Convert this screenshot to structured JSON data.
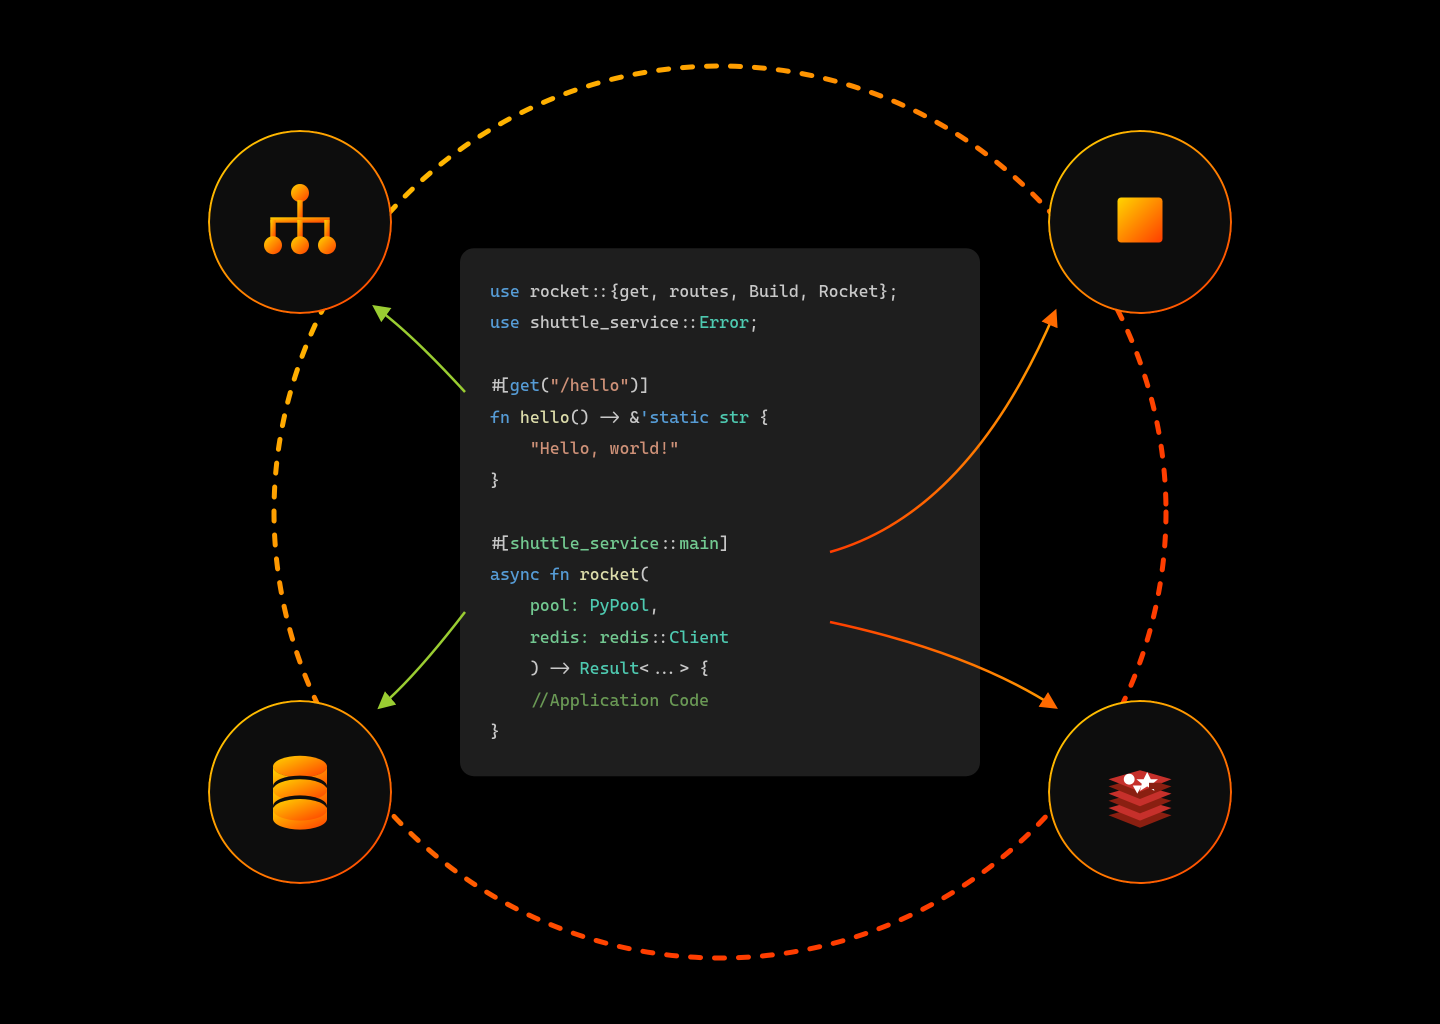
{
  "diagram": {
    "colors": {
      "bg": "#000000",
      "card_bg": "#1e1e1e",
      "gradient_start": "#ffd500",
      "gradient_mid": "#ff8a00",
      "gradient_end": "#ff3d00",
      "arrow_green": "#9acd32",
      "arrow_orange": "#ff6a00"
    },
    "nodes": {
      "top_left": "load-balancer",
      "top_right": "compute-chip",
      "bottom_left": "database",
      "bottom_right": "redis"
    }
  },
  "code": {
    "line1_a": "use",
    "line1_b": " rocket::{get, routes, Build, Rocket};",
    "line2_a": "use",
    "line2_b": " shuttle_service::",
    "line2_c": "Error",
    "line2_d": ";",
    "line4_a": "#[",
    "line4_b": "get",
    "line4_c": "(",
    "line4_d": "\"/hello\"",
    "line4_e": ")]",
    "line5_a": "fn",
    "line5_b": " hello",
    "line5_c": "() -> &",
    "line5_d": "'static",
    "line5_e": " str",
    "line5_f": " {",
    "line6": "    \"Hello, world!\"",
    "line7": "}",
    "line9_a": "#[",
    "line9_b": "shuttle_service",
    "line9_c": "::",
    "line9_d": "main",
    "line9_e": "]",
    "line10_a": "async",
    "line10_b": " fn",
    "line10_c": " rocket",
    "line10_d": "(",
    "line11_a": "    pool: ",
    "line11_b": "PyPool",
    "line11_c": ",",
    "line12_a": "    redis: ",
    "line12_b": "redis",
    "line12_c": "::",
    "line12_d": "Client",
    "line13_a": "    ) -> ",
    "line13_b": "Result",
    "line13_c": "<...> {",
    "line14": "    //Application Code",
    "line15": "}"
  }
}
